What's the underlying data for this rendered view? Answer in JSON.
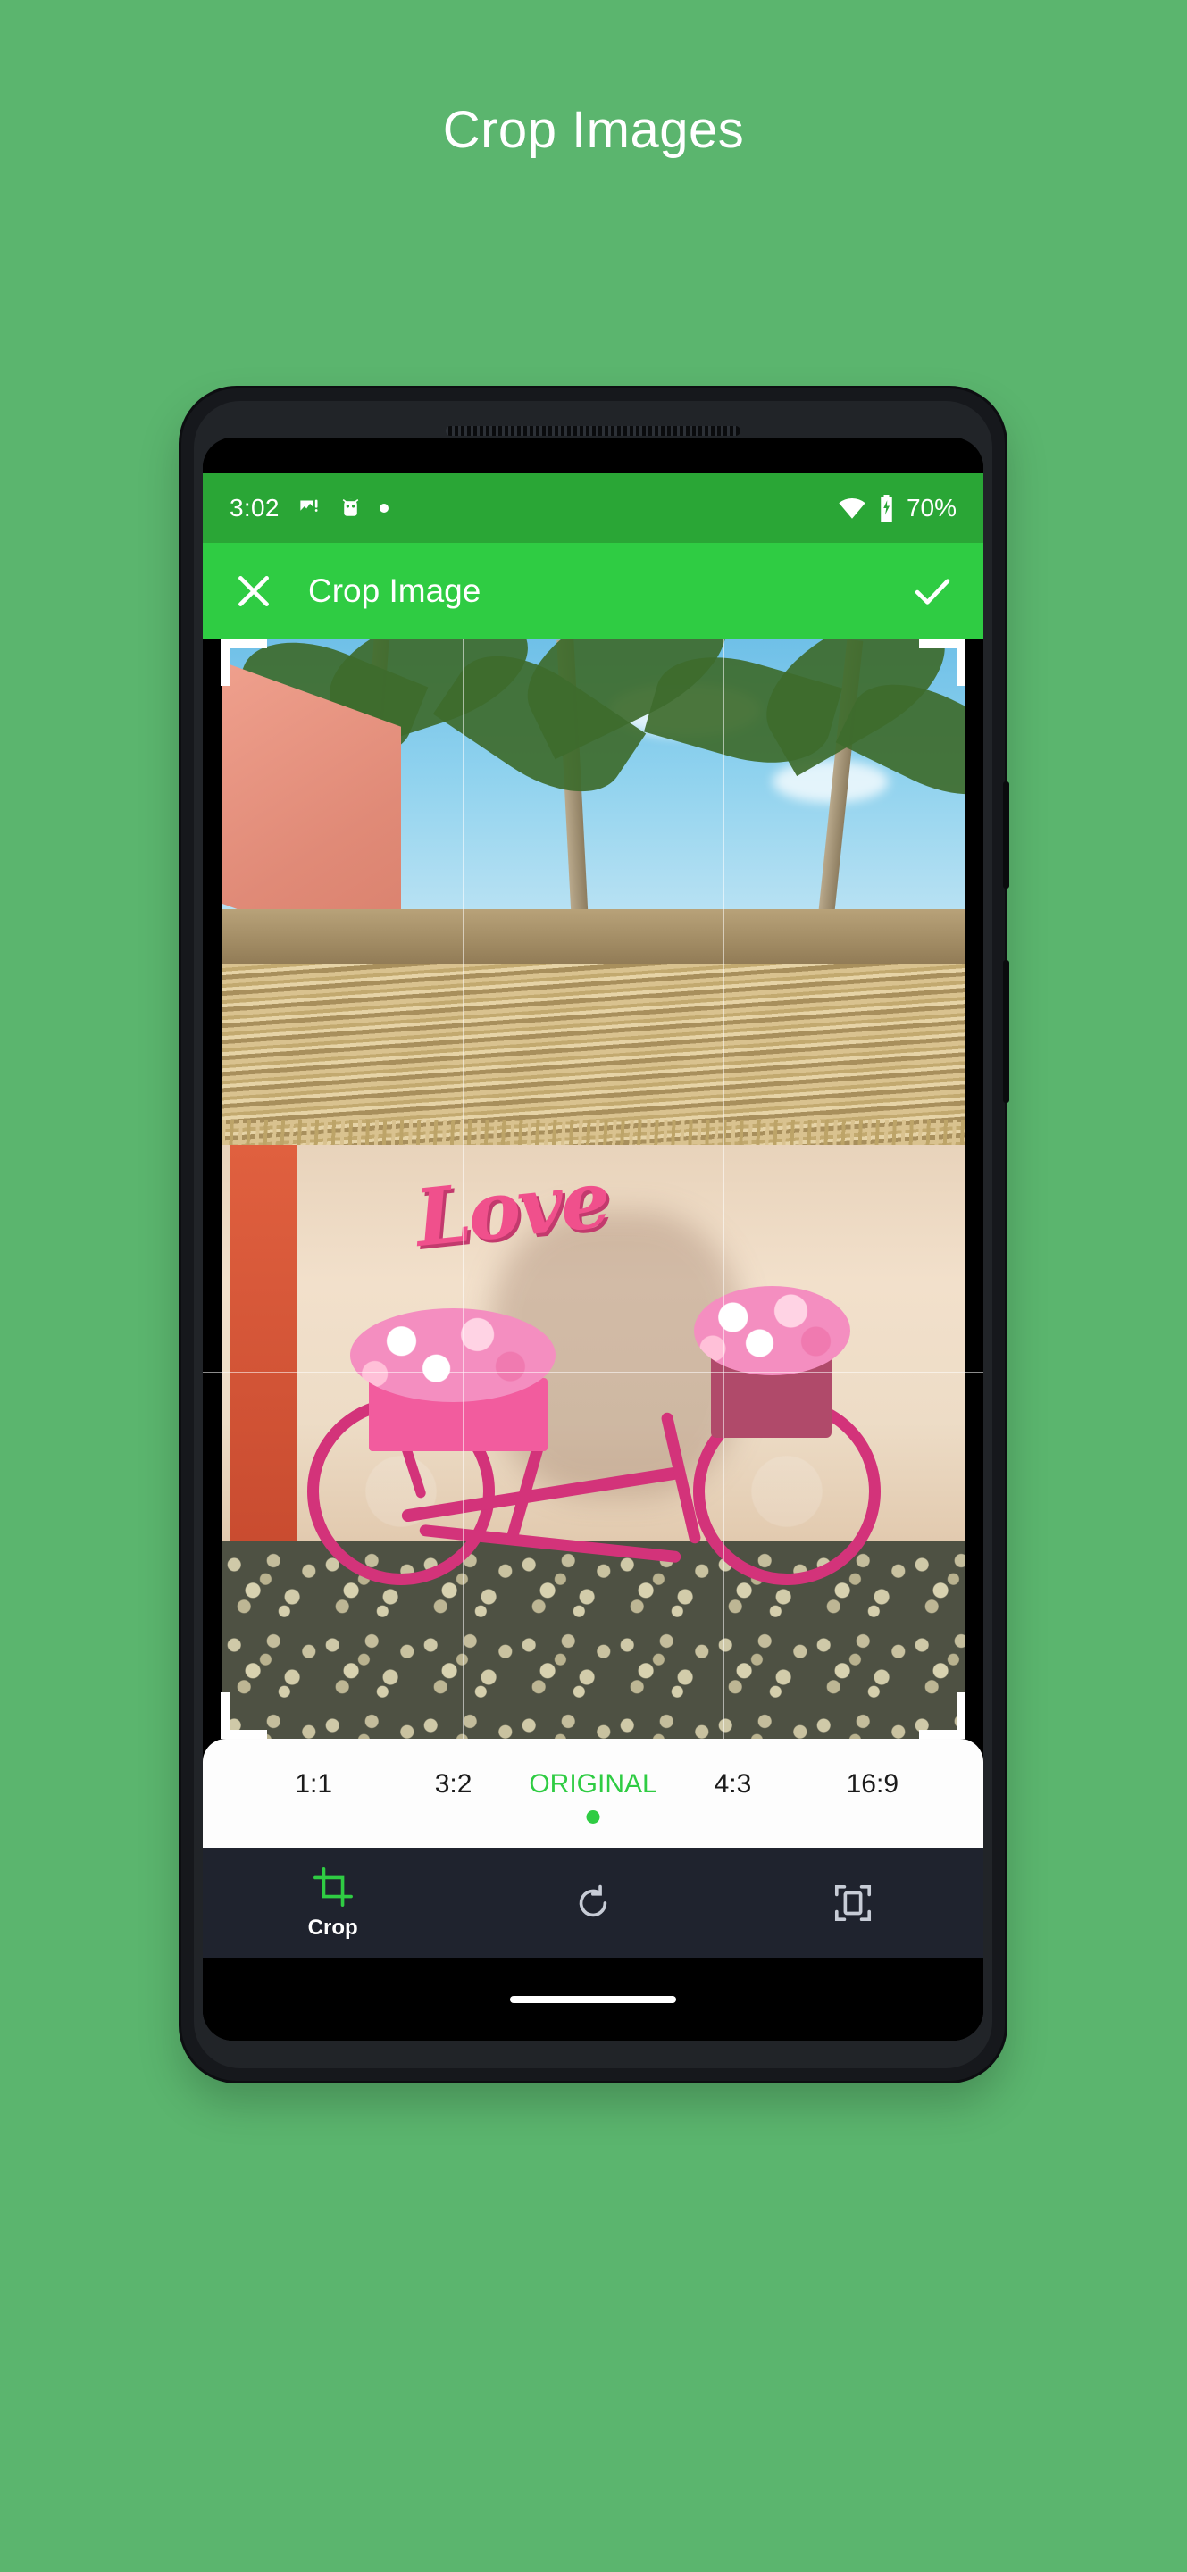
{
  "page": {
    "title": "Crop Images",
    "background_color": "#5bb56e"
  },
  "phone": {
    "status_bar": {
      "time": "3:02",
      "background_color": "#2aa636",
      "notification_icons": [
        "image-warning-icon",
        "android-head-icon",
        "dot-icon"
      ],
      "wifi_icon": "wifi-icon",
      "battery_icon": "battery-charging-icon",
      "battery_percent": "70%"
    },
    "toolbar": {
      "close_label": "close-icon",
      "title": "Crop Image",
      "confirm_label": "check-icon",
      "background_color": "#2fcc43"
    },
    "editor": {
      "photo_description": "Pink bicycle with flower baskets in front of a thatched hut with a pink Love sign",
      "sign_text": "Love",
      "grid_visible": true,
      "handles_visible": true
    },
    "ratio_bar": {
      "background_color": "#fdfdfd",
      "selected_color": "#2fcc43",
      "items": [
        {
          "label": "1:1",
          "selected": false
        },
        {
          "label": "3:2",
          "selected": false
        },
        {
          "label": "ORIGINAL",
          "selected": true
        },
        {
          "label": "4:3",
          "selected": false
        },
        {
          "label": "16:9",
          "selected": false
        }
      ]
    },
    "bottom_bar": {
      "background_color": "#1f232e",
      "items": [
        {
          "icon": "crop-icon",
          "label": "Crop",
          "active": true
        },
        {
          "icon": "rotate-icon",
          "label": "",
          "active": false
        },
        {
          "icon": "scale-fit-icon",
          "label": "",
          "active": false
        }
      ]
    }
  }
}
